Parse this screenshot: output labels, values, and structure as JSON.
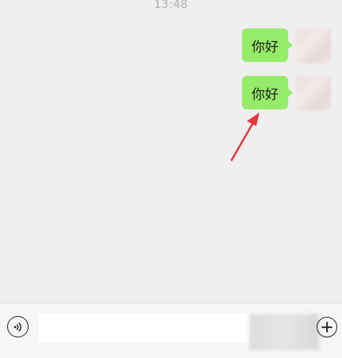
{
  "chat": {
    "timestamp": "13:48",
    "messages": [
      {
        "text": "你好",
        "sender": "self"
      },
      {
        "text": "你好",
        "sender": "self"
      }
    ]
  },
  "annotation": {
    "arrow_color": "#e0393e",
    "target": "second-message"
  },
  "input_bar": {
    "voice_icon": "voice-icon",
    "plus_icon": "plus-icon",
    "text_value": ""
  },
  "colors": {
    "bubble": "#95ec69",
    "background": "#efefef"
  }
}
